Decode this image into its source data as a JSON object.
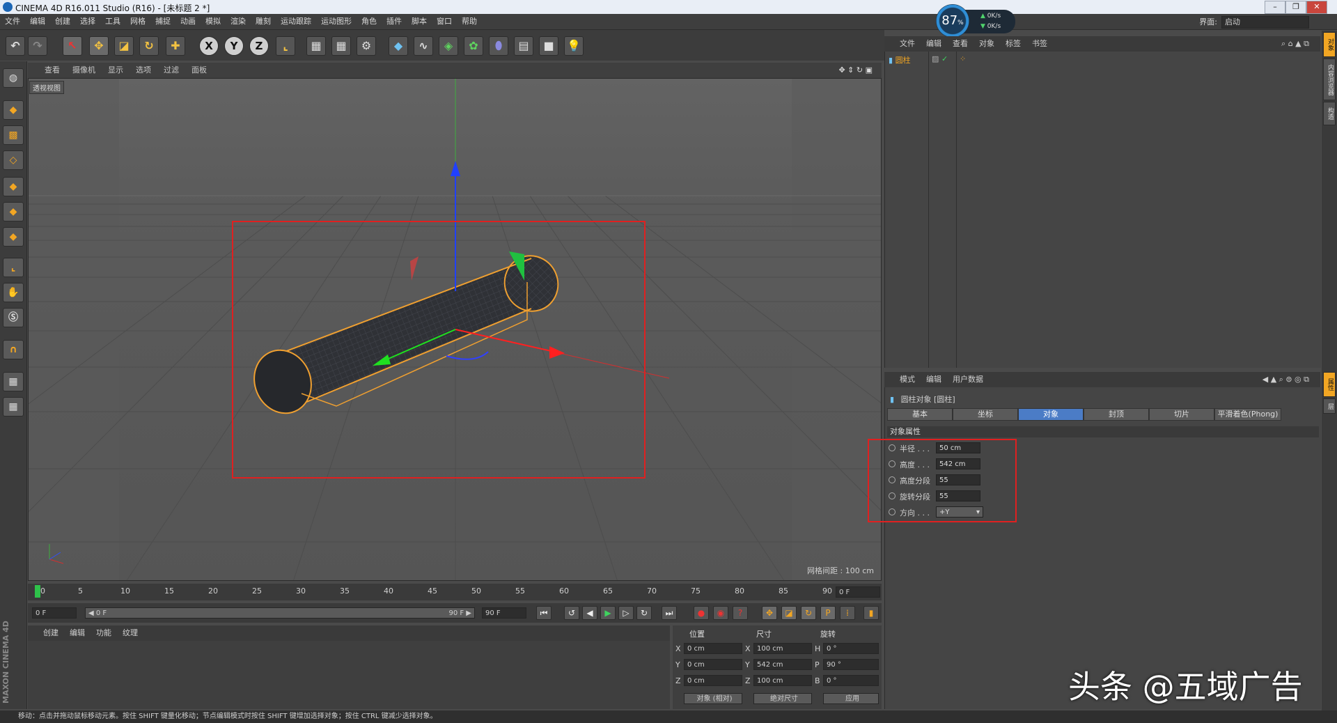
{
  "window": {
    "title": "CINEMA 4D R16.011 Studio (R16) - [未标题 2 *]",
    "minimize": "–",
    "restore": "❐",
    "close": "✕"
  },
  "menu": [
    "文件",
    "编辑",
    "创建",
    "选择",
    "工具",
    "网格",
    "捕捉",
    "动画",
    "模拟",
    "渲染",
    "雕刻",
    "运动跟踪",
    "运动图形",
    "角色",
    "插件",
    "脚本",
    "窗口",
    "帮助"
  ],
  "interface": {
    "label": "界面:",
    "value": "启动"
  },
  "net_widget": {
    "percent": "87",
    "percent_unit": "%",
    "up": "0K/s",
    "down": "0K/s"
  },
  "toolbar": {
    "x": "X",
    "y": "Y",
    "z": "Z"
  },
  "viewport": {
    "menu": [
      "查看",
      "摄像机",
      "显示",
      "选项",
      "过滤",
      "面板"
    ],
    "view_name": "透视视图",
    "grid_spacing": "网格间距 : 100 cm"
  },
  "timeline": {
    "ticks": [
      "0",
      "5",
      "10",
      "15",
      "20",
      "25",
      "30",
      "35",
      "40",
      "45",
      "50",
      "55",
      "60",
      "65",
      "70",
      "75",
      "80",
      "85",
      "90"
    ],
    "current_frame": "0 F",
    "start_field": "0 F",
    "range_start": "◀ 0 F",
    "range_end": "90 F ▶",
    "end_field": "90 F"
  },
  "material_manager": {
    "menu": [
      "创建",
      "编辑",
      "功能",
      "纹理"
    ]
  },
  "coordinates": {
    "headers": {
      "position": "位置",
      "size": "尺寸",
      "rotation": "旋转"
    },
    "rows": [
      {
        "axis": "X",
        "pos": "0 cm",
        "saxis": "X",
        "size": "100 cm",
        "raxis": "H",
        "rot": "0 °"
      },
      {
        "axis": "Y",
        "pos": "0 cm",
        "saxis": "Y",
        "size": "542 cm",
        "raxis": "P",
        "rot": "90 °"
      },
      {
        "axis": "Z",
        "pos": "0 cm",
        "saxis": "Z",
        "size": "100 cm",
        "raxis": "B",
        "rot": "0 °"
      }
    ],
    "mode": "对象 (相对)",
    "size_mode": "绝对尺寸",
    "apply": "应用"
  },
  "object_manager": {
    "menu": [
      "文件",
      "编辑",
      "查看",
      "对象",
      "标签",
      "书签"
    ],
    "object_name": "圆柱"
  },
  "attributes": {
    "menu": [
      "模式",
      "编辑",
      "用户数据"
    ],
    "object_title": "圆柱对象 [圆柱]",
    "tabs": [
      "基本",
      "坐标",
      "对象",
      "封顶",
      "切片",
      "平滑着色(Phong)"
    ],
    "active_tab": "对象",
    "section": "对象属性",
    "params": [
      {
        "label": "半径 . . .",
        "value": "50 cm"
      },
      {
        "label": "高度 . . .",
        "value": "542 cm"
      },
      {
        "label": "高度分段",
        "value": "55"
      },
      {
        "label": "旋转分段",
        "value": "55"
      },
      {
        "label": "方向 . . .",
        "value": "+Y"
      }
    ]
  },
  "right_tabs": [
    "对象",
    "内容浏览器",
    "构造",
    "属性",
    "层"
  ],
  "maxon_logo": "MAXON CINEMA 4D",
  "status": "移动：点击并拖动鼠标移动元素。按住 SHIFT 键量化移动；节点编辑模式时按住 SHIFT 键增加选择对象；按住 CTRL 键减少选择对象。",
  "watermark": "头条 @五域广告"
}
